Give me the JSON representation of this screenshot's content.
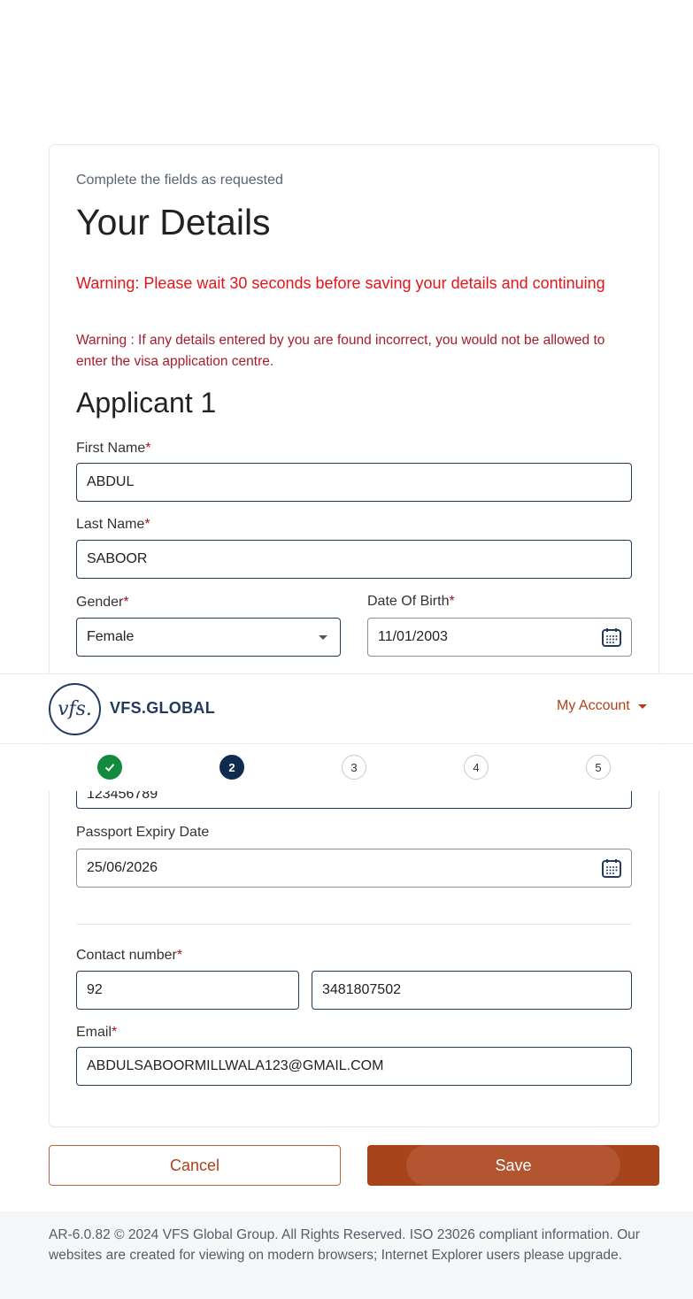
{
  "form": {
    "subtitle": "Complete the fields as requested",
    "title": "Your Details",
    "warning_wait": "Warning: Please wait 30 seconds before saving your details and continuing",
    "warning_incorrect": "Warning : If any details entered by you are found incorrect, you would not be allowed to enter the visa application centre.",
    "applicant_heading": "Applicant 1",
    "required_mark": "*",
    "first_name": {
      "label": "First Name",
      "value": "ABDUL"
    },
    "last_name": {
      "label": "Last Name",
      "value": "SABOOR"
    },
    "gender": {
      "label": "Gender",
      "value": "Female"
    },
    "dob": {
      "label": "Date Of Birth",
      "value": "11/01/2003"
    },
    "passport_number": {
      "value": "123456789"
    },
    "passport_expiry": {
      "label": "Passport Expiry Date",
      "value": "25/06/2026"
    },
    "contact": {
      "label": "Contact number",
      "code": "92",
      "number": "3481807502"
    },
    "email": {
      "label": "Email",
      "value": "ABDULSABOORMILLWALA123@GMAIL.COM"
    }
  },
  "header": {
    "logo_mark": "vfs.",
    "logo_text": "VFS.GLOBAL",
    "account_label": "My Account"
  },
  "stepper": {
    "current": 2,
    "steps": [
      "1",
      "2",
      "3",
      "4",
      "5"
    ]
  },
  "buttons": {
    "cancel": "Cancel",
    "save": "Save"
  },
  "footer": {
    "text": "AR-6.0.82 © 2024 VFS Global Group. All Rights Reserved. ISO 23026 compliant information. Our websites are created for viewing on modern browsers; Internet Explorer users please upgrade."
  },
  "colors": {
    "brand_navy": "#0f2c4f",
    "accent_orange": "#a8441b",
    "warning_red": "#e3151b",
    "success_green": "#138a3d"
  }
}
